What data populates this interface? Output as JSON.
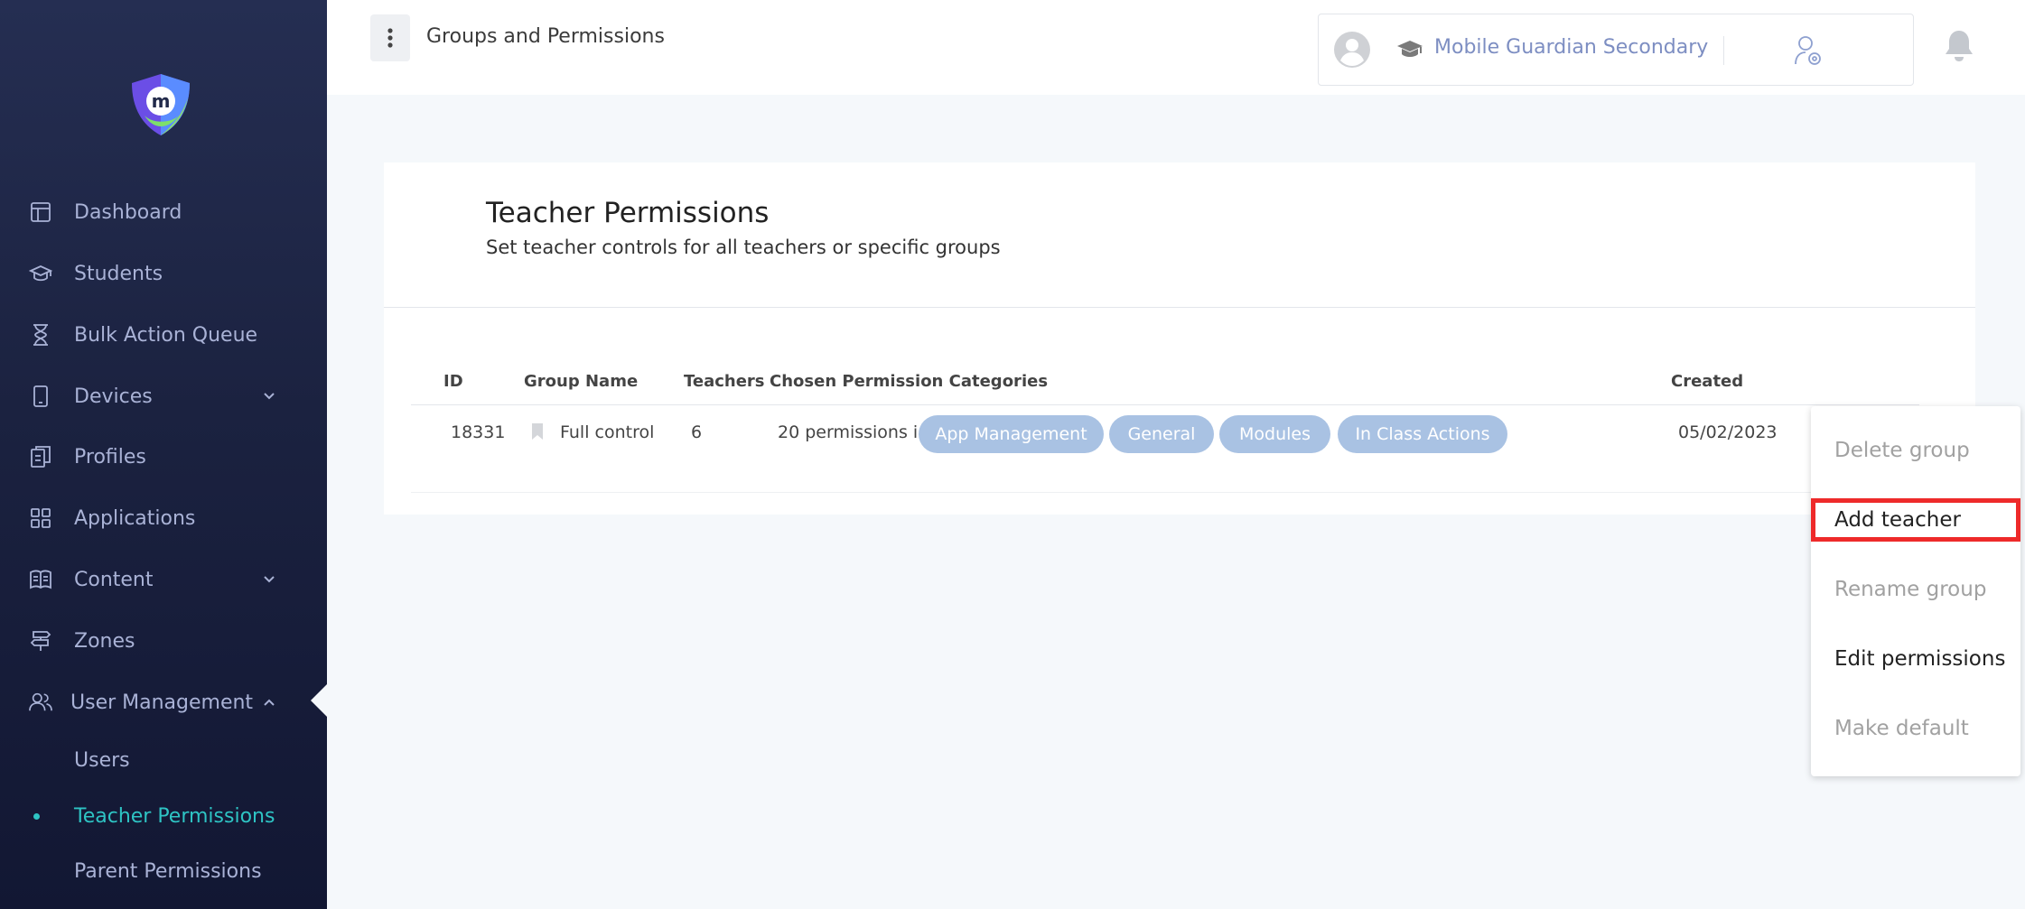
{
  "sidebar": {
    "items": [
      {
        "label": "Dashboard",
        "icon": "dashboard-icon"
      },
      {
        "label": "Students",
        "icon": "graduation-cap-icon"
      },
      {
        "label": "Bulk Action Queue",
        "icon": "hourglass-icon"
      },
      {
        "label": "Devices",
        "icon": "mobile-device-icon",
        "expandable": true
      },
      {
        "label": "Profiles",
        "icon": "documents-icon"
      },
      {
        "label": "Applications",
        "icon": "grid-icon"
      },
      {
        "label": "Content",
        "icon": "book-icon",
        "expandable": true
      },
      {
        "label": "Zones",
        "icon": "signpost-icon"
      },
      {
        "label": "User Management",
        "icon": "users-icon",
        "expanded": true
      }
    ],
    "sub_items": [
      {
        "label": "Users"
      },
      {
        "label": "Teacher Permissions",
        "active": true
      },
      {
        "label": "Parent Permissions"
      }
    ]
  },
  "header": {
    "title": "Groups and Permissions",
    "school_name": "Mobile Guardian Secondary"
  },
  "card": {
    "title": "Teacher Permissions",
    "subtitle": "Set teacher controls for all teachers or specific groups"
  },
  "table": {
    "columns": [
      "ID",
      "Group Name",
      "Teachers",
      "Chosen Permission Categories",
      "Created"
    ],
    "rows": [
      {
        "id": "18331",
        "group_name": "Full control",
        "teachers": "6",
        "permissions_text": "20 permissions in",
        "categories": [
          "App Management",
          "General",
          "Modules",
          "In Class Actions"
        ],
        "created": "05/02/2023"
      }
    ]
  },
  "dropdown": {
    "items": [
      {
        "label": "Delete group",
        "enabled": false
      },
      {
        "label": "Add teacher",
        "enabled": true,
        "highlighted": true
      },
      {
        "label": "Rename group",
        "enabled": false
      },
      {
        "label": "Edit permissions",
        "enabled": true
      },
      {
        "label": "Make default",
        "enabled": false
      }
    ]
  },
  "colors": {
    "sidebar_bg": "#1b2240",
    "sidebar_text": "#a9b2d6",
    "active_text": "#2ec4c4",
    "chip_bg": "#a9c2e3",
    "highlight": "#ee2a2a"
  }
}
